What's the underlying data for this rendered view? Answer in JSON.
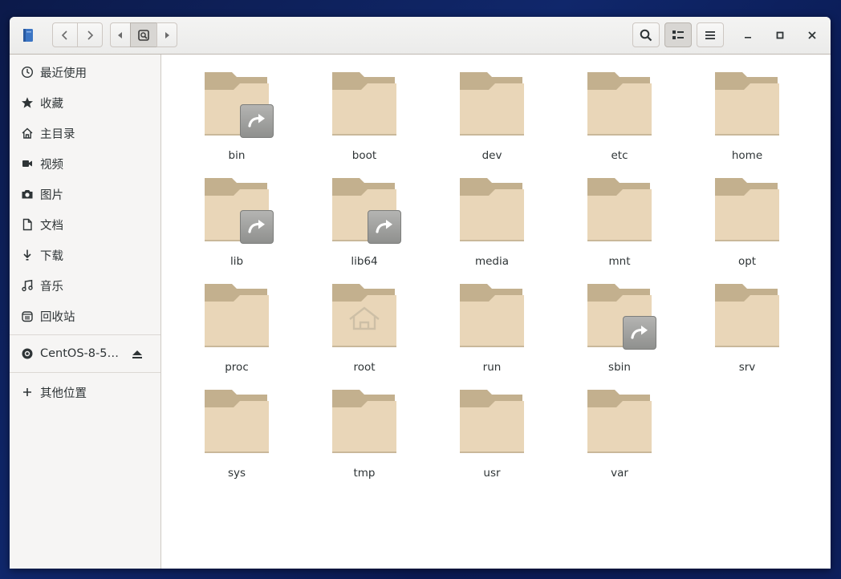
{
  "sidebar": {
    "items": [
      {
        "label": "最近使用",
        "icon": "clock-icon"
      },
      {
        "label": "收藏",
        "icon": "star-icon"
      },
      {
        "label": "主目录",
        "icon": "home-icon"
      },
      {
        "label": "视频",
        "icon": "video-icon"
      },
      {
        "label": "图片",
        "icon": "camera-icon"
      },
      {
        "label": "文档",
        "icon": "document-icon"
      },
      {
        "label": "下载",
        "icon": "download-icon"
      },
      {
        "label": "音乐",
        "icon": "music-icon"
      },
      {
        "label": "回收站",
        "icon": "trash-icon"
      }
    ],
    "device": {
      "label": "CentOS-8-5…",
      "icon": "disc-icon",
      "eject_icon": "eject-icon"
    },
    "other": {
      "label": "其他位置",
      "icon": "plus-icon"
    }
  },
  "files": [
    {
      "name": "bin",
      "symlink": true
    },
    {
      "name": "boot",
      "symlink": false
    },
    {
      "name": "dev",
      "symlink": false
    },
    {
      "name": "etc",
      "symlink": false
    },
    {
      "name": "home",
      "symlink": false
    },
    {
      "name": "lib",
      "symlink": true
    },
    {
      "name": "lib64",
      "symlink": true
    },
    {
      "name": "media",
      "symlink": false
    },
    {
      "name": "mnt",
      "symlink": false
    },
    {
      "name": "opt",
      "symlink": false
    },
    {
      "name": "proc",
      "symlink": false
    },
    {
      "name": "root",
      "symlink": false,
      "home_emblem": true
    },
    {
      "name": "run",
      "symlink": false
    },
    {
      "name": "sbin",
      "symlink": true
    },
    {
      "name": "srv",
      "symlink": false
    },
    {
      "name": "sys",
      "symlink": false
    },
    {
      "name": "tmp",
      "symlink": false
    },
    {
      "name": "usr",
      "symlink": false
    },
    {
      "name": "var",
      "symlink": false
    }
  ],
  "colors": {
    "folder_back": "#c3b08e",
    "folder_front": "#e9d6b8",
    "accent_bg": "#0f246a"
  }
}
